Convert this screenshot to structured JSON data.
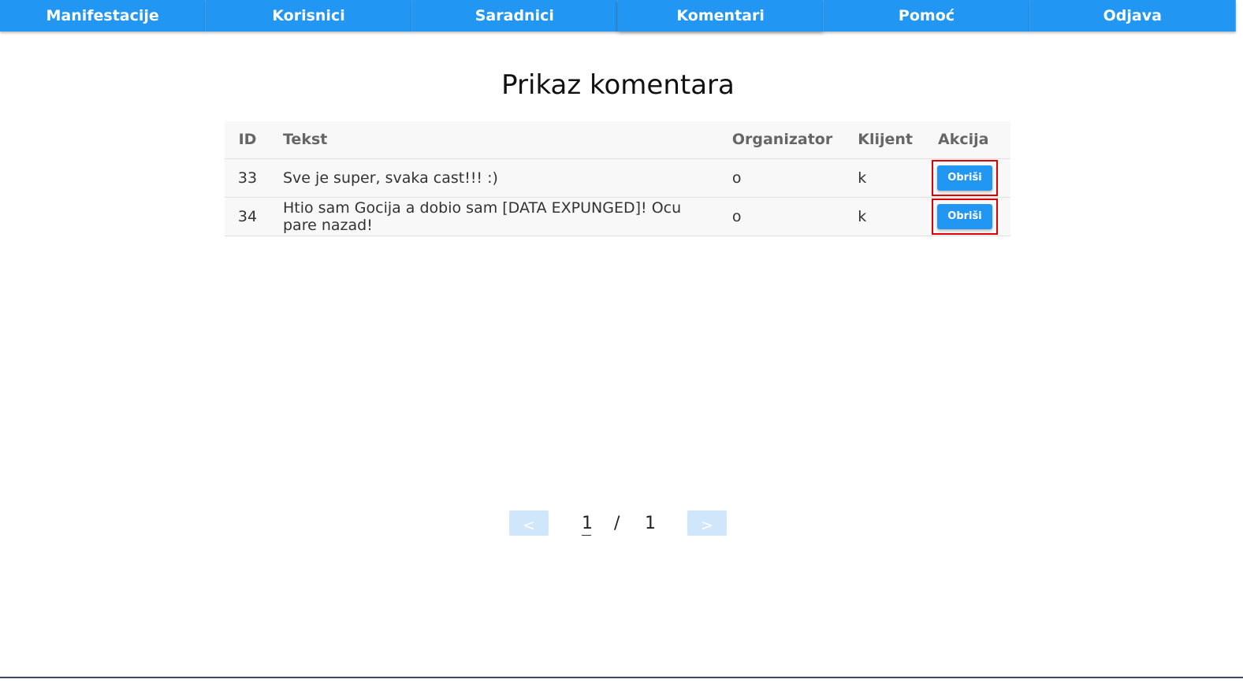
{
  "nav": {
    "items": [
      {
        "label": "Manifestacije"
      },
      {
        "label": "Korisnici"
      },
      {
        "label": "Saradnici"
      },
      {
        "label": "Komentari"
      },
      {
        "label": "Pomoć"
      },
      {
        "label": "Odjava"
      }
    ],
    "active": "Komentari"
  },
  "page": {
    "title": "Prikaz komentara"
  },
  "table": {
    "headers": {
      "id": "ID",
      "tekst": "Tekst",
      "organizator": "Organizator",
      "klijent": "Klijent",
      "akcija": "Akcija"
    },
    "rows": [
      {
        "id": "33",
        "tekst": "Sve je super, svaka cast!!! :)",
        "organizator": "o",
        "klijent": "k",
        "action_label": "Obriši"
      },
      {
        "id": "34",
        "tekst": "Htio sam Gocija a dobio sam [DATA EXPUNGED]! Ocu pare nazad!",
        "organizator": "o",
        "klijent": "k",
        "action_label": "Obriši"
      }
    ]
  },
  "pager": {
    "prev_label": "<",
    "next_label": ">",
    "current": "1",
    "separator": "/",
    "total": "1"
  },
  "colors": {
    "accent": "#2196f3",
    "highlight_border": "#e00000"
  }
}
